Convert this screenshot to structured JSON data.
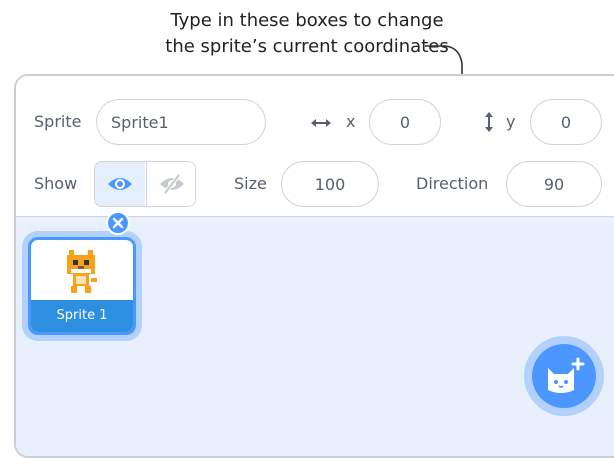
{
  "callout": {
    "line1": "Type in these boxes to change",
    "line2": "the sprite’s current coordinates"
  },
  "sprite_info": {
    "sprite_label": "Sprite",
    "sprite_name": "Sprite1",
    "x_label": "x",
    "x_value": "0",
    "y_label": "y",
    "y_value": "0",
    "show_label": "Show",
    "show_state": "visible",
    "size_label": "Size",
    "size_value": "100",
    "direction_label": "Direction",
    "direction_value": "90"
  },
  "sprite_list": {
    "items": [
      {
        "name": "Sprite 1",
        "selected": true
      }
    ]
  },
  "colors": {
    "accent": "#4c97ff",
    "selected_bar": "#2d8fe0",
    "list_background": "#e8f0fd",
    "label_text": "#575e75",
    "cat_orange": "#f7a21c"
  },
  "icons": {
    "x_arrow": "horizontal-arrows-icon",
    "y_arrow": "vertical-arrows-icon",
    "show": "eye-icon",
    "hide": "eye-slash-icon",
    "delete": "close-icon",
    "add_sprite": "cat-plus-icon"
  }
}
